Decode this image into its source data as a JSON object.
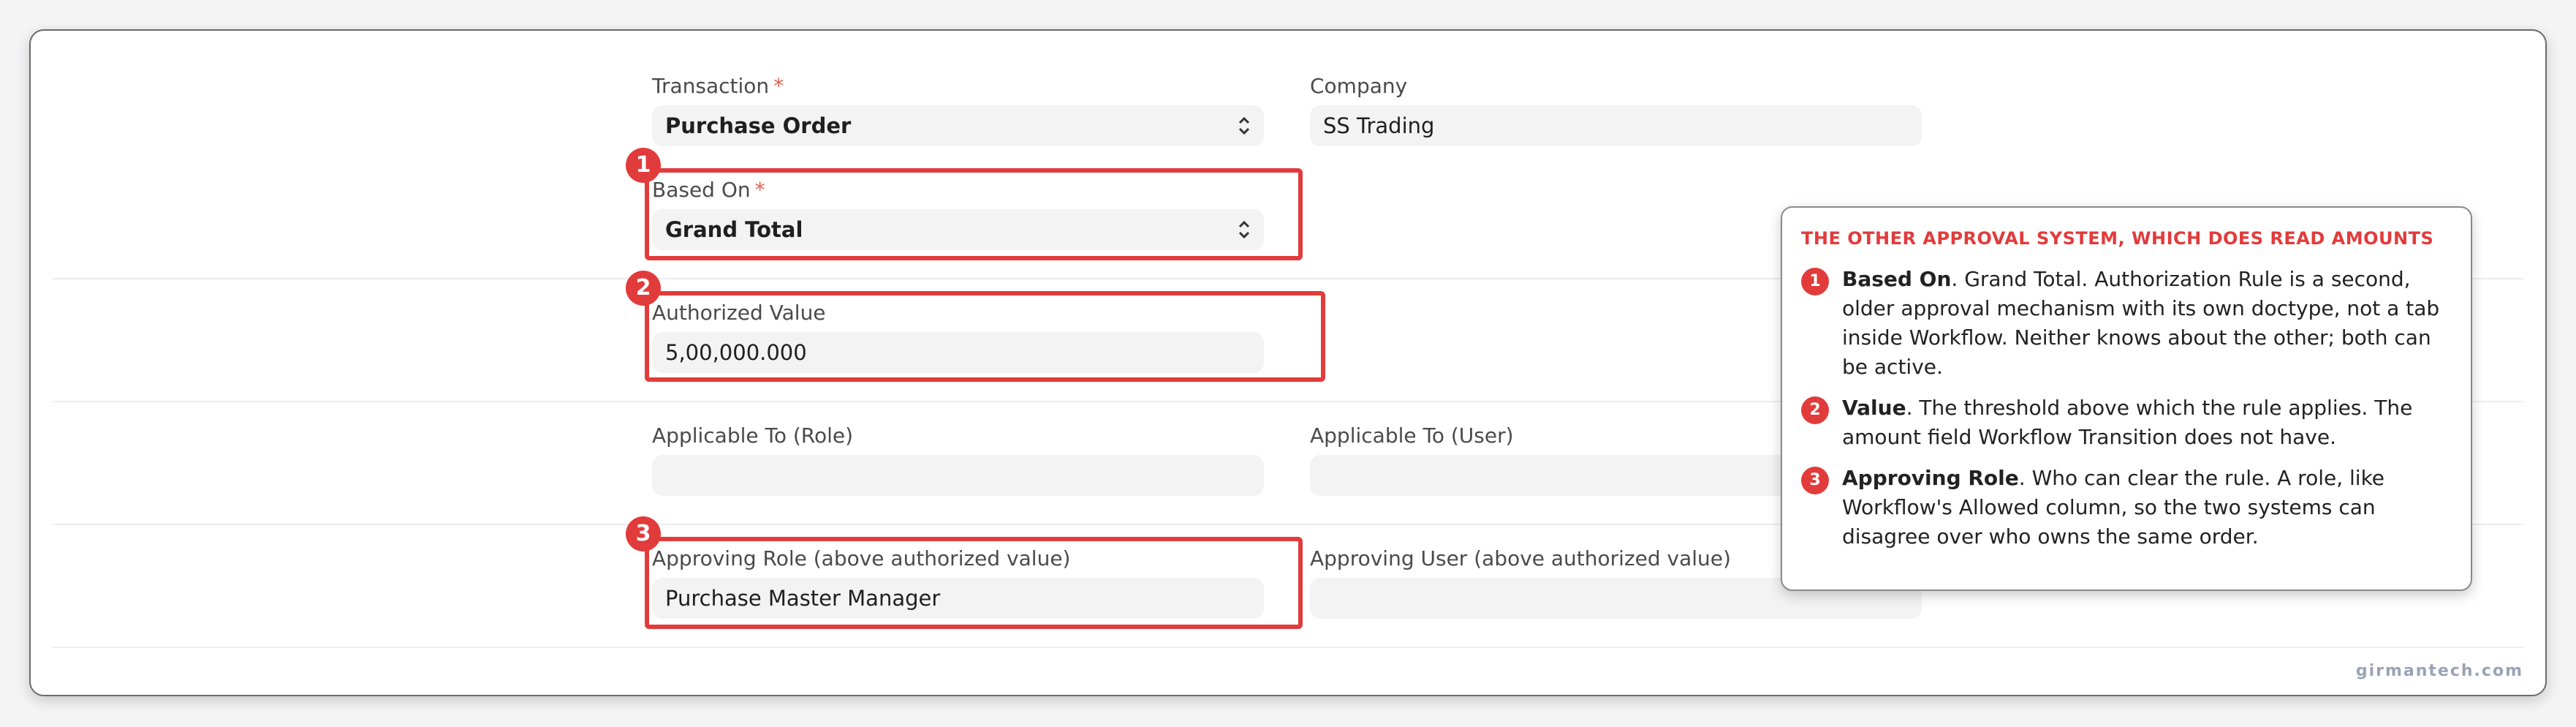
{
  "form": {
    "transaction": {
      "label": "Transaction",
      "required": "*",
      "value": "Purchase Order"
    },
    "company": {
      "label": "Company",
      "value": "SS Trading"
    },
    "based_on": {
      "label": "Based On",
      "required": "*",
      "value": "Grand Total"
    },
    "authorized_value": {
      "label": "Authorized Value",
      "value": "5,00,000.000"
    },
    "applicable_role": {
      "label": "Applicable To (Role)",
      "value": ""
    },
    "applicable_user": {
      "label": "Applicable To (User)",
      "value": ""
    },
    "approving_role": {
      "label": "Approving Role (above authorized value)",
      "value": "Purchase Master Manager"
    },
    "approving_user": {
      "label": "Approving User (above authorized value)",
      "value": ""
    }
  },
  "callouts": {
    "badges": [
      "1",
      "2",
      "3"
    ],
    "title": "THE OTHER APPROVAL SYSTEM, WHICH DOES READ AMOUNTS",
    "notes": [
      {
        "num": "1",
        "head": "Based On",
        "text": ". Grand Total. Authorization Rule is a second, older approval mechanism with its own doctype, not a tab inside Workflow. Neither knows about the other; both can be active."
      },
      {
        "num": "2",
        "head": "Value",
        "text": ". The threshold above which the rule applies. The amount field Workflow Transition does not have."
      },
      {
        "num": "3",
        "head": "Approving Role",
        "text": ". Who can clear the rule. A role, like Workflow's Allowed column, so the two systems can disagree over who owns the same order."
      }
    ]
  },
  "watermark": "girmantech.com",
  "colors": {
    "accent": "#e23b3b",
    "field_bg": "#f3f3f3",
    "required": "#e85a4f"
  },
  "icons": {
    "select": "up-down-chevron-icon"
  }
}
